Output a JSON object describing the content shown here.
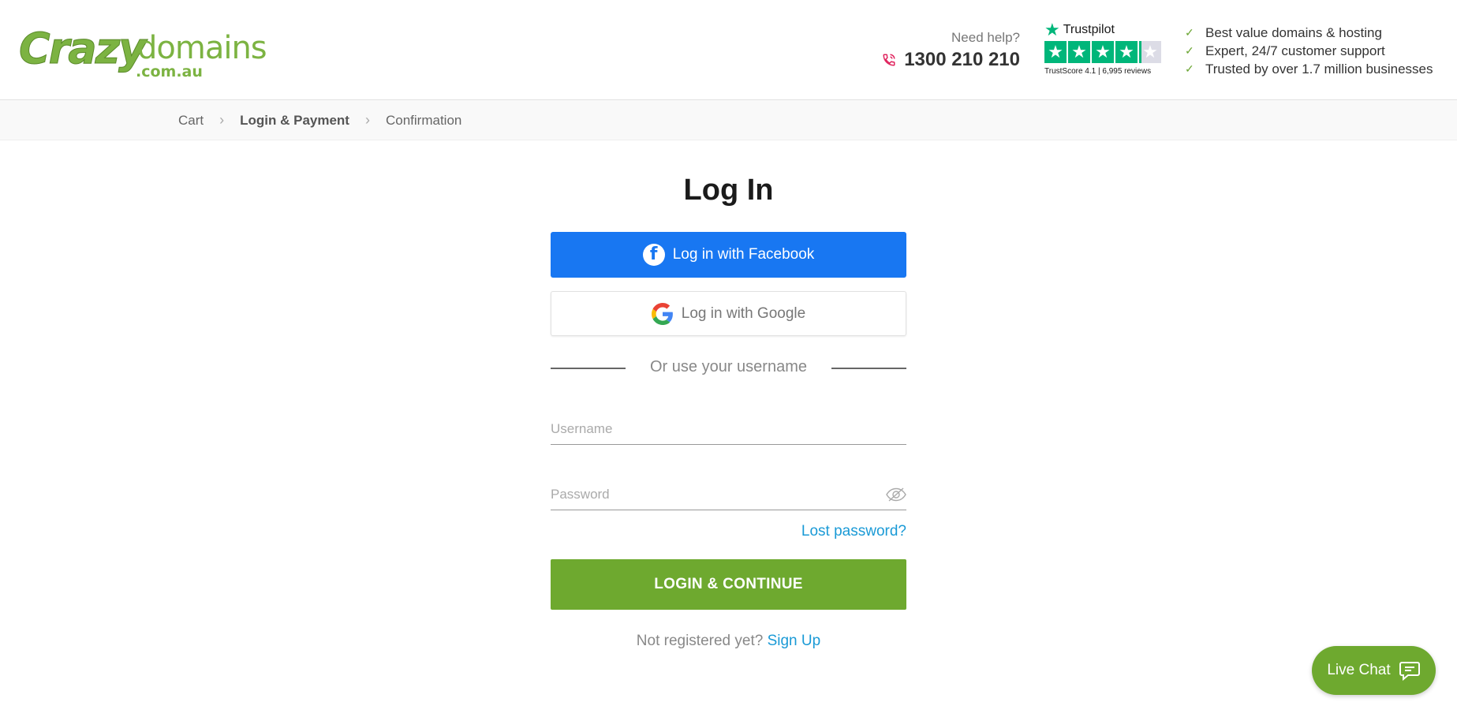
{
  "header": {
    "logo": {
      "crazy": "Crazy",
      "domains": "domains",
      "tld": ".com.au"
    },
    "help": {
      "need_help": "Need help?",
      "phone": "1300 210 210"
    },
    "trustpilot": {
      "brand": "Trustpilot",
      "score_text": "TrustScore 4.1 | 6,995 reviews",
      "rating": 4.1,
      "max": 5
    },
    "usps": [
      "Best value domains & hosting",
      "Expert, 24/7 customer support",
      "Trusted by over 1.7 million businesses"
    ]
  },
  "breadcrumb": {
    "steps": [
      "Cart",
      "Login & Payment",
      "Confirmation"
    ],
    "active_index": 1
  },
  "login": {
    "title": "Log In",
    "facebook_label": "Log in with Facebook",
    "google_label": "Log in with Google",
    "divider_text": "Or use your username",
    "username_placeholder": "Username",
    "username_value": "",
    "password_placeholder": "Password",
    "password_value": "",
    "lost_password": "Lost password?",
    "submit_label": "LOGIN & CONTINUE",
    "not_registered": "Not registered yet?",
    "sign_up": "Sign Up"
  },
  "chat": {
    "label": "Live Chat"
  },
  "colors": {
    "brand_green": "#6ea92f",
    "facebook_blue": "#1877f2",
    "link_blue": "#1a9ad6",
    "trustpilot_green": "#00b67a"
  }
}
